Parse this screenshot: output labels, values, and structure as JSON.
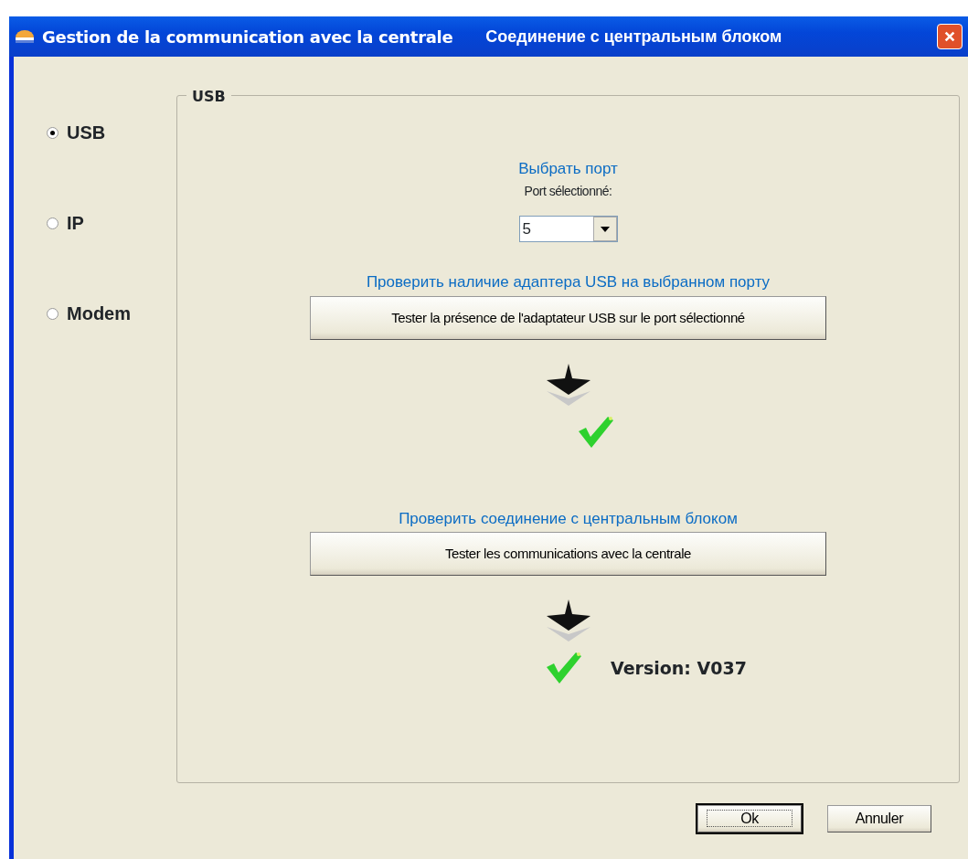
{
  "window": {
    "title": "Gestion de la communication avec la centrale",
    "title_annotation": "Соединение с центральным блоком"
  },
  "connection_types": [
    {
      "label": "USB",
      "selected": true
    },
    {
      "label": "IP",
      "selected": false
    },
    {
      "label": "Modem",
      "selected": false
    }
  ],
  "group": {
    "title": "USB",
    "port": {
      "annotation": "Выбрать порт",
      "label": "Port sélectionné:",
      "value": "5"
    },
    "steps": [
      {
        "annotation": "Проверить наличие адаптера USB на выбранном порту",
        "button": "Tester la présence de l'adaptateur USB sur le port sélectionné",
        "result_ok": true
      },
      {
        "annotation": "Проверить соединение с центральным блоком",
        "button": "Tester les communications avec la centrale",
        "result_ok": true,
        "result_text": "Version: V037"
      }
    ]
  },
  "buttons": [
    {
      "label": "Ok",
      "default": true
    },
    {
      "label": "Annuler",
      "default": false
    }
  ]
}
